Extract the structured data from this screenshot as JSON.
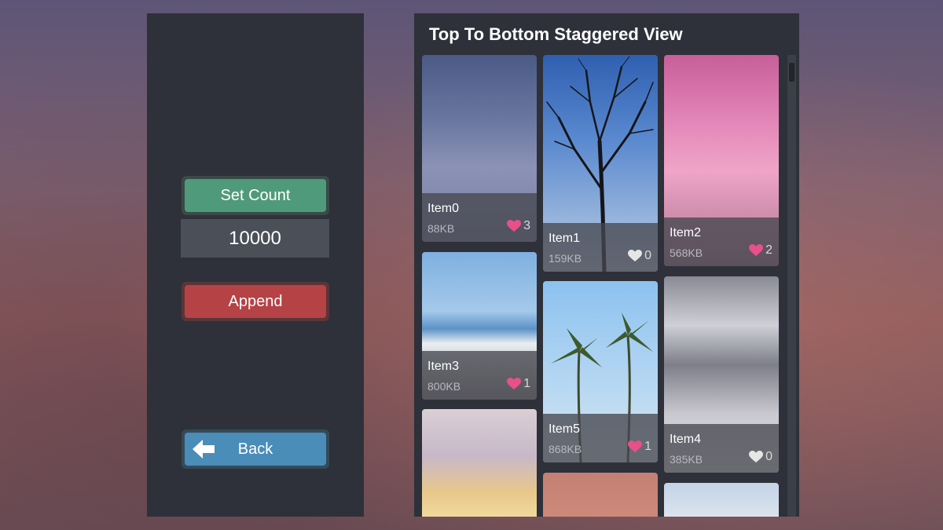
{
  "left_panel": {
    "set_count_label": "Set Count",
    "count_value": "10000",
    "append_label": "Append",
    "back_label": "Back"
  },
  "staggered_view": {
    "title": "Top To Bottom Staggered View",
    "items": [
      {
        "name": "Item0",
        "size": "88KB",
        "likes": "3",
        "liked": true
      },
      {
        "name": "Item1",
        "size": "159KB",
        "likes": "0",
        "liked": false
      },
      {
        "name": "Item2",
        "size": "568KB",
        "likes": "2",
        "liked": true
      },
      {
        "name": "Item3",
        "size": "800KB",
        "likes": "1",
        "liked": true
      },
      {
        "name": "Item5",
        "size": "868KB",
        "likes": "1",
        "liked": true
      },
      {
        "name": "Item4",
        "size": "385KB",
        "likes": "0",
        "liked": false
      }
    ]
  },
  "colors": {
    "heart_liked": "#e8508a",
    "heart_unliked": "#e6e6e6",
    "set_count_button": "#4f9a7a",
    "append_button": "#b54245",
    "back_button": "#4a8db8"
  }
}
